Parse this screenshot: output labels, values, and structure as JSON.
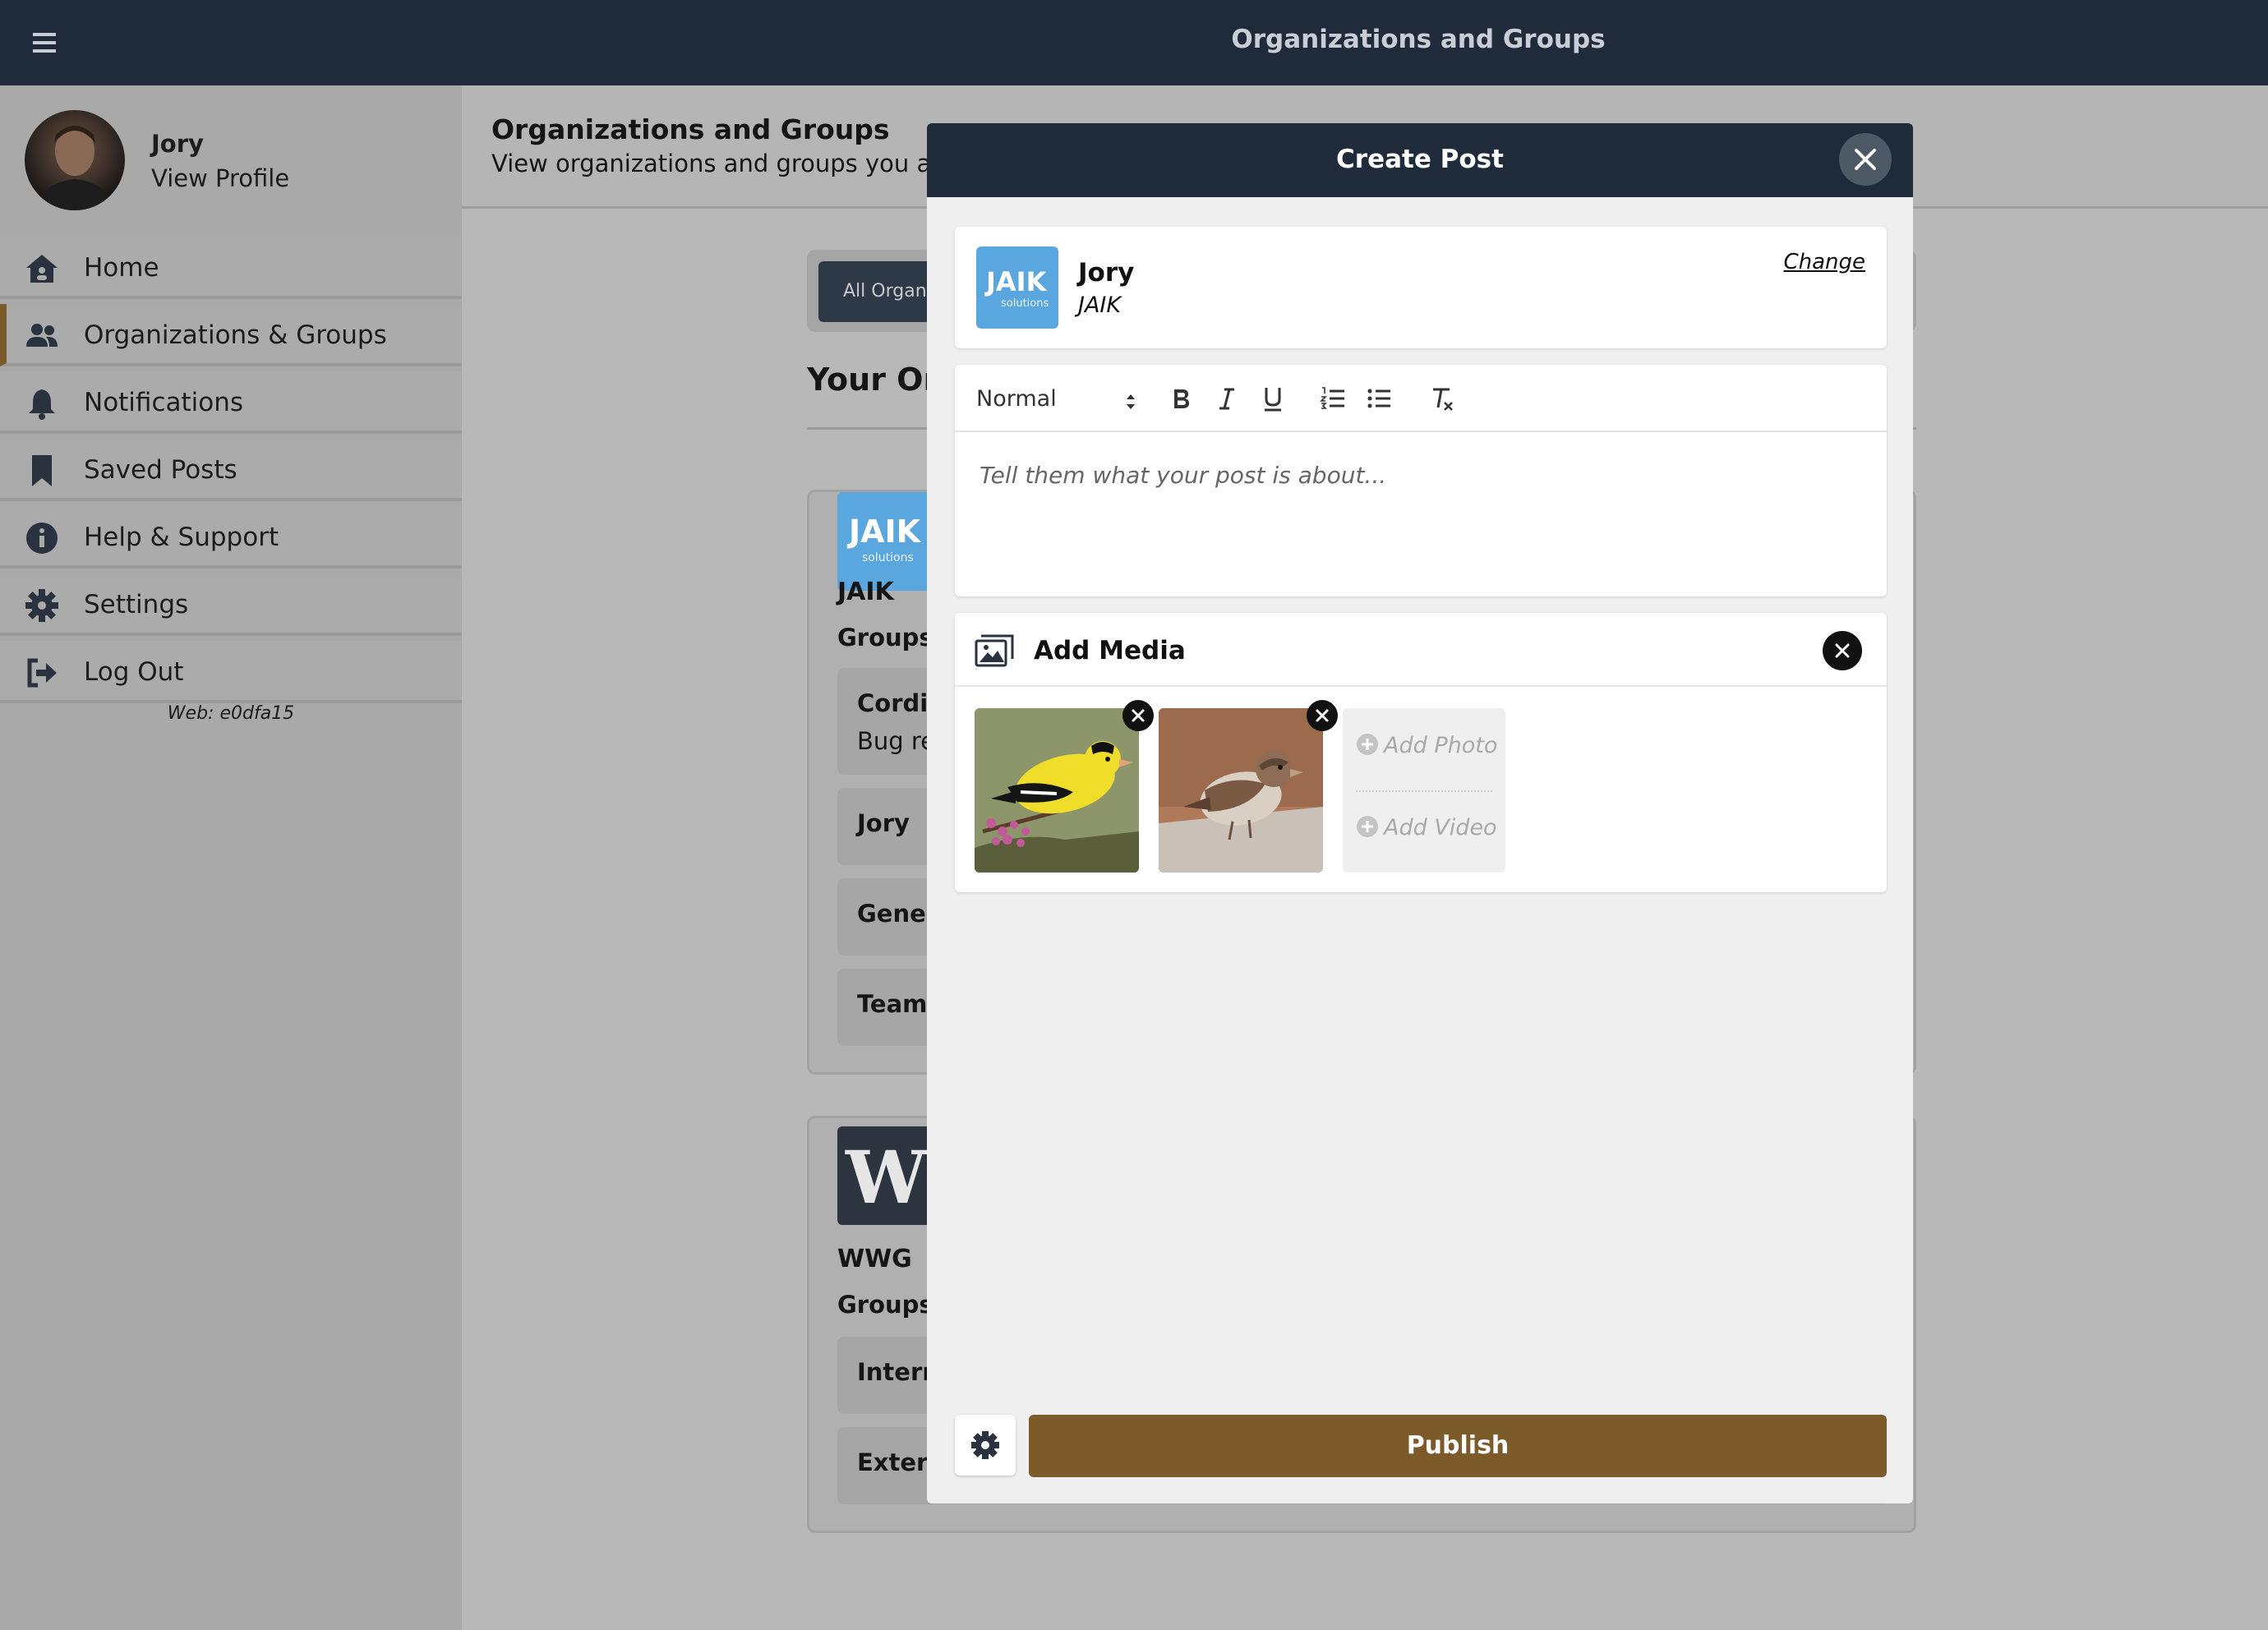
{
  "topbar": {
    "title": "Organizations and Groups"
  },
  "profile": {
    "name": "Jory",
    "view_profile": "View Profile"
  },
  "nav": {
    "items": [
      {
        "label": "Home"
      },
      {
        "label": "Organizations & Groups"
      },
      {
        "label": "Notifications"
      },
      {
        "label": "Saved Posts"
      },
      {
        "label": "Help & Support"
      },
      {
        "label": "Settings"
      },
      {
        "label": "Log Out"
      }
    ],
    "active_index": 1,
    "web_version": "Web: e0dfa15"
  },
  "main": {
    "title": "Organizations and Groups",
    "subtitle": "View organizations and groups you are a",
    "filter_tab": "All Organi",
    "your_orgs": "Your Or",
    "orgs": [
      {
        "logo_text": "JAIK",
        "logo_sub": "solutions",
        "name": "JAIK",
        "groups_label": "Groups",
        "groups": [
          {
            "name": "Cordin",
            "sub": "Bug re"
          },
          {
            "name": "Jory"
          },
          {
            "name": "Genera"
          },
          {
            "name": "Team"
          }
        ]
      },
      {
        "logo_text": "W",
        "name": "WWG",
        "groups_label": "Groups",
        "groups": [
          {
            "name": "Intern"
          },
          {
            "name": "Extern"
          }
        ]
      }
    ]
  },
  "modal": {
    "title": "Create Post",
    "author": {
      "logo_text": "JAIK",
      "logo_sub": "solutions",
      "name": "Jory",
      "org": "JAIK",
      "change_label": "Change"
    },
    "editor": {
      "format": "Normal",
      "placeholder": "Tell them what your post is about..."
    },
    "media": {
      "title": "Add Media",
      "add_photo": "Add Photo",
      "add_video": "Add Video",
      "images": [
        "goldfinch-photo",
        "sparrow-photo"
      ]
    },
    "publish_label": "Publish"
  },
  "colors": {
    "navy": "#1f2b3a",
    "accent": "#7c5a2a",
    "jaik_blue": "#5aa6df"
  }
}
